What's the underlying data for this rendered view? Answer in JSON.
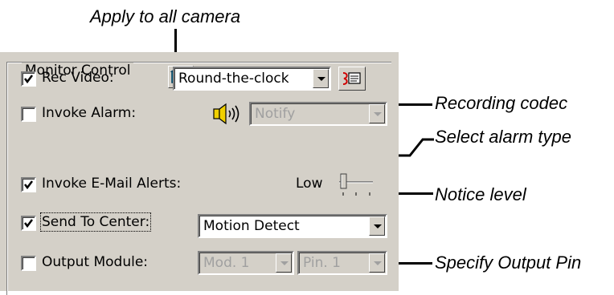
{
  "callouts": {
    "apply_all": "Apply to all camera",
    "recording_codec": "Recording codec",
    "alarm_type": "Select alarm type",
    "notice_level": "Notice level",
    "output_pin": "Specify Output Pin"
  },
  "group": {
    "title": "Monitor Control",
    "apply_icon": "camera-apply-icon"
  },
  "rows": {
    "rec_video": {
      "label": "Rec Video:",
      "checked": true,
      "select_value": "Round-the-clock",
      "codec_icon": "codec-settings-icon"
    },
    "invoke_alarm": {
      "label": "Invoke Alarm:",
      "checked": false,
      "icon": "speaker-icon",
      "select_value": "Notify",
      "disabled": true
    },
    "email_alerts": {
      "label": "Invoke E-Mail Alerts:",
      "checked": true,
      "level_label": "Low"
    },
    "send_center": {
      "label": "Send To Center:",
      "checked": true,
      "select_value": "Motion Detect"
    },
    "output_module": {
      "label": "Output Module:",
      "checked": false,
      "module_value": "Mod. 1",
      "pin_value": "Pin. 1",
      "disabled": true
    }
  },
  "colors": {
    "panel": "#d4d0c8",
    "shadow": "#808080",
    "disabled_text": "#a0a0a0"
  }
}
